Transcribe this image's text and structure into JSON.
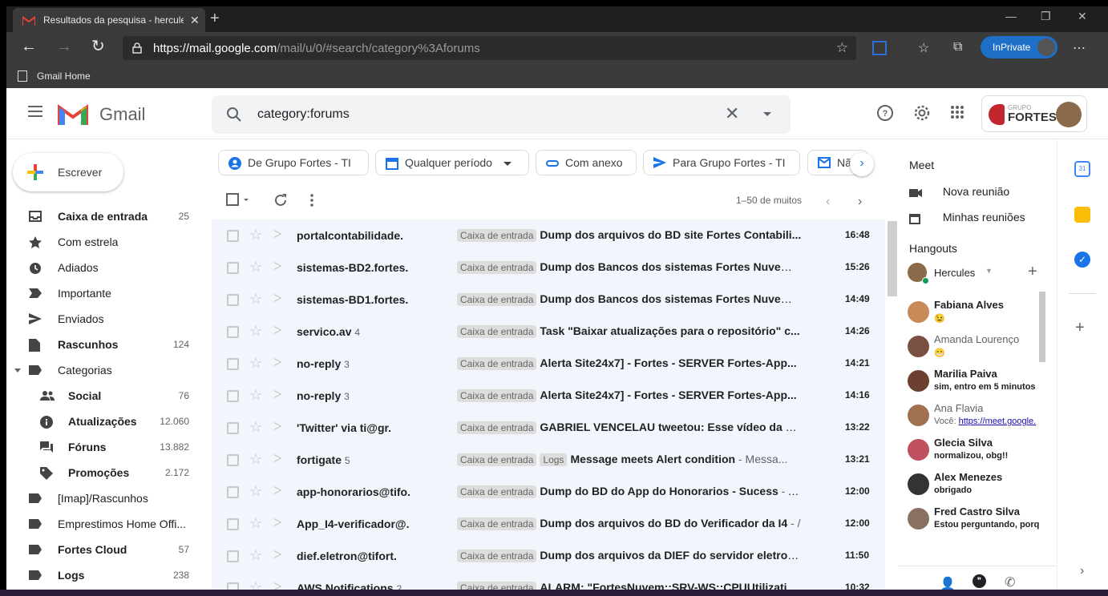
{
  "browser": {
    "tab_title": "Resultados da pesquisa - hercule",
    "url_prefix": "https://",
    "url_host": "mail.google.com",
    "url_path": "/mail/u/0/#search/category%3Aforums",
    "inprivate_label": "InPrivate",
    "favorites": [
      "Gmail Home"
    ]
  },
  "gmail": {
    "app_name": "Gmail",
    "search_query": "category:forums",
    "account_brand_top": "GRUPO",
    "account_brand_name": "FORTES"
  },
  "sidebar": {
    "compose_label": "Escrever",
    "items": [
      {
        "label": "Caixa de entrada",
        "count": "25",
        "icon": "inbox-icon",
        "bold": true
      },
      {
        "label": "Com estrela",
        "count": "",
        "icon": "star-icon",
        "bold": false
      },
      {
        "label": "Adiados",
        "count": "",
        "icon": "clock-icon",
        "bold": false
      },
      {
        "label": "Importante",
        "count": "",
        "icon": "label-important-icon",
        "bold": false
      },
      {
        "label": "Enviados",
        "count": "",
        "icon": "send-icon",
        "bold": false
      },
      {
        "label": "Rascunhos",
        "count": "124",
        "icon": "draft-icon",
        "bold": true
      },
      {
        "label": "Categorias",
        "count": "",
        "icon": "label-icon",
        "bold": false
      },
      {
        "label": "Social",
        "count": "76",
        "icon": "people-icon",
        "bold": true
      },
      {
        "label": "Atualizações",
        "count": "12.060",
        "icon": "info-icon",
        "bold": true
      },
      {
        "label": "Fóruns",
        "count": "13.882",
        "icon": "forum-icon",
        "bold": true
      },
      {
        "label": "Promoções",
        "count": "2.172",
        "icon": "tag-icon",
        "bold": true
      },
      {
        "label": "[Imap]/Rascunhos",
        "count": "",
        "icon": "label-icon",
        "bold": false
      },
      {
        "label": "Emprestimos Home Offi...",
        "count": "",
        "icon": "label-icon",
        "bold": false
      },
      {
        "label": "Fortes Cloud",
        "count": "57",
        "icon": "label-icon",
        "bold": true
      },
      {
        "label": "Logs",
        "count": "238",
        "icon": "label-icon",
        "bold": true
      }
    ]
  },
  "chips": [
    "De Grupo Fortes - TI",
    "Qualquer período",
    "Com anexo",
    "Para Grupo Fortes - TI",
    "Não lido"
  ],
  "list": {
    "pager": "1–50 de muitos",
    "rows": [
      {
        "sender": "portalcontabilidade.",
        "count": "",
        "tags": [
          "Caixa de entrada"
        ],
        "subject": "Dump dos arquivos do BD site Fortes Contabili...",
        "snippet": "",
        "time": "16:48"
      },
      {
        "sender": "sistemas-BD2.fortes.",
        "count": "",
        "tags": [
          "Caixa de entrada"
        ],
        "subject": "Dump dos Bancos dos sistemas Fortes Nuvem ...",
        "snippet": "",
        "time": "15:26"
      },
      {
        "sender": "sistemas-BD1.fortes.",
        "count": "",
        "tags": [
          "Caixa de entrada"
        ],
        "subject": "Dump dos Bancos dos sistemas Fortes Nuvem ...",
        "snippet": "",
        "time": "14:49"
      },
      {
        "sender": "servico.av",
        "count": "4",
        "tags": [
          "Caixa de entrada"
        ],
        "subject": "Task \"Baixar atualizações para o repositório\" c...",
        "snippet": "",
        "time": "14:26"
      },
      {
        "sender": "no-reply",
        "count": "3",
        "tags": [
          "Caixa de entrada"
        ],
        "subject": "Alerta Site24x7] - Fortes - SERVER Fortes-App...",
        "snippet": "",
        "time": "14:21"
      },
      {
        "sender": "no-reply",
        "count": "3",
        "tags": [
          "Caixa de entrada"
        ],
        "subject": "Alerta Site24x7] - Fortes - SERVER Fortes-App...",
        "snippet": "",
        "time": "14:16"
      },
      {
        "sender": "'Twitter' via ti@gr.",
        "count": "",
        "tags": [
          "Caixa de entrada"
        ],
        "subject": "GABRIEL VENCELAU tweetou: Esse vídeo da Bi...",
        "snippet": "",
        "time": "13:22"
      },
      {
        "sender": "fortigate",
        "count": "5",
        "tags": [
          "Caixa de entrada",
          "Logs"
        ],
        "subject": "Message meets Alert condition",
        "snippet": " - Messa...",
        "time": "13:21"
      },
      {
        "sender": "app-honorarios@tifo.",
        "count": "",
        "tags": [
          "Caixa de entrada"
        ],
        "subject": "Dump do BD do App do Honorarios - Sucess",
        "snippet": " - A...",
        "time": "12:00"
      },
      {
        "sender": "App_I4-verificador@.",
        "count": "",
        "tags": [
          "Caixa de entrada"
        ],
        "subject": "Dump dos arquivos do BD do Verificador da I4",
        "snippet": " - /",
        "time": "12:00"
      },
      {
        "sender": "dief.eletron@tifort.",
        "count": "",
        "tags": [
          "Caixa de entrada"
        ],
        "subject": "Dump dos arquivos da DIEF do servidor eletron...",
        "snippet": "",
        "time": "11:50"
      },
      {
        "sender": "AWS Notifications",
        "count": "2",
        "tags": [
          "Caixa de entrada"
        ],
        "subject": "ALARM: \"FortesNuvem::SRV-WS::CPUUtilizatio...",
        "snippet": "",
        "time": "10:32"
      }
    ]
  },
  "meet": {
    "title": "Meet",
    "new_meeting": "Nova reunião",
    "my_meetings": "Minhas reuniões"
  },
  "hangouts": {
    "title": "Hangouts",
    "me": "Hercules",
    "contacts": [
      {
        "name": "Fabiana Alves",
        "msg": "😉",
        "bold": true,
        "link": ""
      },
      {
        "name": "Amanda Lourenço",
        "msg": "😁",
        "bold": false,
        "link": ""
      },
      {
        "name": "Marilia Paiva",
        "msg": "sim, entro em 5 minutos",
        "bold": true,
        "link": ""
      },
      {
        "name": "Ana Flavia",
        "msg": "Você: ",
        "bold": false,
        "link": "https://meet.google."
      },
      {
        "name": "Glecia Silva",
        "msg": "normalizou, obg!!",
        "bold": true,
        "link": ""
      },
      {
        "name": "Alex Menezes",
        "msg": "obrigado",
        "bold": true,
        "link": ""
      },
      {
        "name": "Fred Castro Silva",
        "msg": "Estou perguntando, porq",
        "bold": true,
        "link": ""
      }
    ]
  },
  "colors": {
    "accent": "#1a73e8",
    "inprivate": "#1e6fc8",
    "row_bg": "#f2f6fc",
    "brand_red": "#c1272d"
  }
}
